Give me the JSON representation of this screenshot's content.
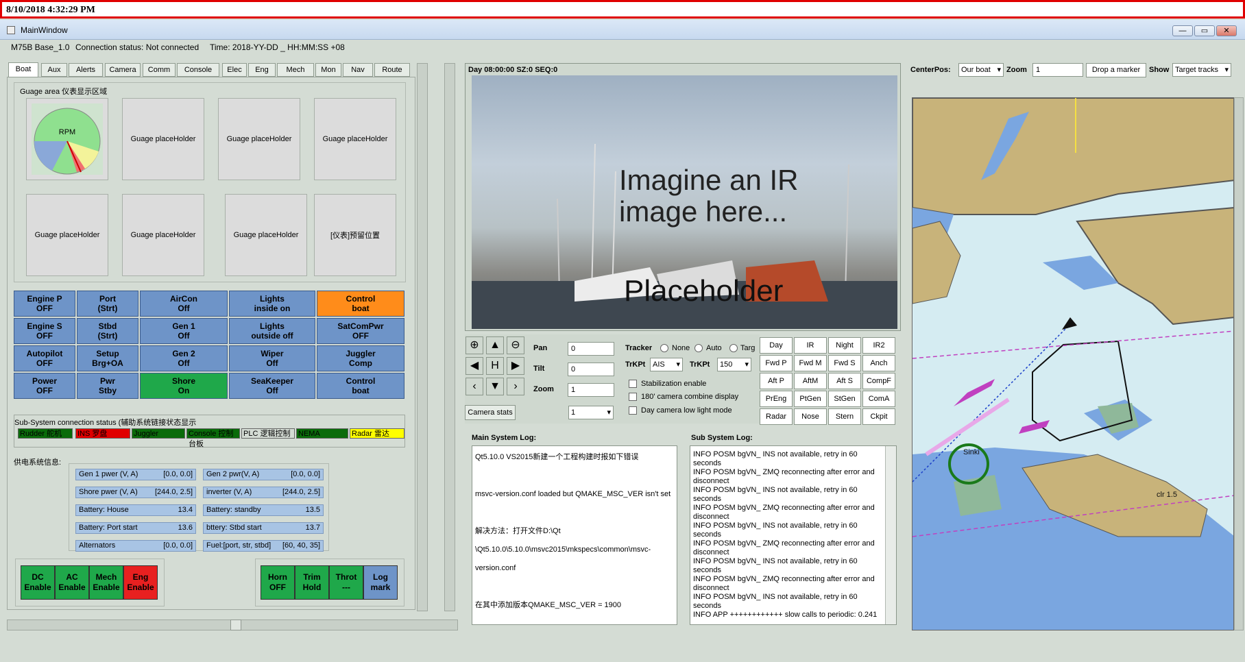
{
  "top_bar": {
    "datetime": "8/10/2018 4:32:29 PM"
  },
  "window": {
    "title": "MainWindow",
    "min": "—",
    "max": "▭",
    "close": "✕"
  },
  "status_bar": {
    "version": "M75B Base_1.0",
    "connection": "Connection status: Not connected",
    "time": "Time: 2018-YY-DD _  HH:MM:SS +08"
  },
  "tabs": [
    "Boat",
    "Aux",
    "Alerts",
    "Camera",
    "Comm",
    "Console",
    "Elec",
    "Eng",
    "Mech",
    "Mon",
    "Nav",
    "Route"
  ],
  "gauge_area": {
    "title": "Guage area 仪表显示区域",
    "rpm_label": "RPM",
    "placeholders": [
      "Guage placeHolder",
      "Guage placeHolder",
      "Guage placeHolder",
      "Guage placeHolder",
      "Guage placeHolder",
      "Guage placeHolder",
      "[仪表]预留位置"
    ]
  },
  "boat_buttons": [
    {
      "label": "Engine P\nOFF"
    },
    {
      "label": "Port\n(Strt)"
    },
    {
      "label": "AirCon\nOff"
    },
    {
      "label": "Lights\ninside on"
    },
    {
      "label": "Control\nboat"
    },
    {
      "label": "Engine S\nOFF"
    },
    {
      "label": "Stbd\n(Strt)"
    },
    {
      "label": "Gen 1\nOff"
    },
    {
      "label": "Lights\noutside off"
    },
    {
      "label": "SatComPwr\nOFF"
    },
    {
      "label": "Autopilot\nOFF"
    },
    {
      "label": "Setup\nBrg+OA"
    },
    {
      "label": "Gen 2\nOff"
    },
    {
      "label": "Wiper\nOff"
    },
    {
      "label": "Juggler\nComp"
    },
    {
      "label": "Power\nOFF"
    },
    {
      "label": "Pwr\nStby"
    },
    {
      "label": "Shore\nOn"
    },
    {
      "label": "SeaKeeper\nOff"
    },
    {
      "label": "Control\nboat"
    }
  ],
  "subsystem": {
    "title": "Sub-System connection status (辅助系统链接状态显示",
    "items": [
      {
        "label": "Rudder 舵机",
        "color": "#0a6b0a"
      },
      {
        "label": "INS 罗盘",
        "color": "#e00000"
      },
      {
        "label": "Juggler",
        "color": "#0a6b0a"
      },
      {
        "label": "Console 控制台板",
        "color": "#0a6b0a"
      },
      {
        "label": "PLC 逻辑控制",
        "color": "#d4dcd4"
      },
      {
        "label": "NEMA",
        "color": "#0a6b0a"
      },
      {
        "label": "Radar 雷达",
        "color": "#ffff00"
      }
    ]
  },
  "power_info": {
    "title": "供电系统信息:",
    "rows": [
      {
        "label": "Gen 1 pwer (V, A)",
        "value": "[0.0, 0.0]"
      },
      {
        "label": "Gen 2 pwr(V, A)",
        "value": "[0.0, 0.0]"
      },
      {
        "label": "Shore pwer (V, A)",
        "value": "[244.0, 2.5]"
      },
      {
        "label": "inverter (V, A)",
        "value": "[244.0, 2.5]"
      },
      {
        "label": "Battery: House",
        "value": "13.4"
      },
      {
        "label": "Battery: standby",
        "value": "13.5"
      },
      {
        "label": "Battery: Port start",
        "value": "13.6"
      },
      {
        "label": "bttery: Stbd start",
        "value": "13.7"
      },
      {
        "label": "Alternators",
        "value": "[0.0, 0.0]"
      },
      {
        "label": "Fuel:[port, str, stbd]",
        "value": "[60, 40, 35]"
      }
    ]
  },
  "bottom_left_buttons": [
    {
      "label": "DC\nEnable",
      "color": "#1fa84a"
    },
    {
      "label": "AC\nEnable",
      "color": "#1fa84a"
    },
    {
      "label": "Mech\nEnable",
      "color": "#1fa84a"
    },
    {
      "label": "Eng\nEnable",
      "color": "#e82020"
    }
  ],
  "bottom_right_buttons": [
    {
      "label": "Horn\nOFF",
      "color": "#1fa84a"
    },
    {
      "label": "Trim\nHold",
      "color": "#1fa84a"
    },
    {
      "label": "Throt\n---",
      "color": "#1fa84a"
    },
    {
      "label": "Log\nmark",
      "color": "#6e94c8"
    }
  ],
  "camera": {
    "header": "Day 08:00:00 SZ:0 SEQ:0",
    "overlay_line1": "Imagine an IR",
    "overlay_line2": "image here...",
    "overlay_placeholder": "Placeholder",
    "pan_label": "Pan",
    "pan_value": "0",
    "tilt_label": "Tilt",
    "tilt_value": "0",
    "zoom_label": "Zoom",
    "zoom_value": "1",
    "stats_button": "Camera stats",
    "select_value": "1",
    "tracker_label": "Tracker",
    "tracker_options": [
      "None",
      "Auto",
      "Targ"
    ],
    "trkpt_label": "TrKPt",
    "trkpt1_value": "AIS",
    "trkpt2_label": "TrKPt",
    "trkpt2_value": "150",
    "checkbox_stab": "Stabilization enable",
    "checkbox_180": "180' camera combine display",
    "checkbox_lowlight": "Day camera low light mode",
    "grid_buttons": [
      "Day",
      "IR",
      "Night",
      "IR2",
      "Fwd P",
      "Fwd M",
      "Fwd S",
      "Anch",
      "Aft P",
      "AftM",
      "Aft S",
      "CompF",
      "PrEng",
      "PtGen",
      "StGen",
      "ComA",
      "Radar",
      "Nose",
      "Stern",
      "Ckpit"
    ]
  },
  "logs": {
    "main_title": "Main System Log:",
    "main_lines": [
      "Qt5.10.0 VS2015新建一个工程构建时报如下错误",
      "",
      "msvc-version.conf loaded but QMAKE_MSC_VER isn't set",
      "",
      "解决方法：打开文件D:\\Qt",
      "\\Qt5.10.0\\5.10.0\\msvc2015\\mkspecs\\common\\msvc-",
      "version.conf",
      "",
      "在其中添加版本QMAKE_MSC_VER = 1900"
    ],
    "sub_title": "Sub System Log:",
    "sub_lines": [
      "INFO    POSM bgVN_ INS not available, retry in 60 seconds",
      "INFO    POSM bgVN_ ZMQ reconnecting after error and disconnect",
      "INFO    POSM bgVN_ INS not available, retry in 60 seconds",
      "INFO    POSM bgVN_ ZMQ reconnecting after error and disconnect",
      "INFO    POSM bgVN_ INS not available, retry in 60 seconds",
      "INFO    POSM bgVN_ ZMQ reconnecting after error and disconnect",
      "INFO    POSM bgVN_ INS not available, retry in 60 seconds",
      "INFO    POSM bgVN_ ZMQ reconnecting after error and disconnect",
      "INFO    POSM bgVN_ INS not available, retry in 60 seconds",
      "INFO    APP   ++++++++++++ slow calls to periodic: 0.241"
    ]
  },
  "map": {
    "centerpos_label": "CenterPos:",
    "centerpos_value": "Our boat",
    "zoom_label": "Zoom",
    "zoom_value": "1",
    "drop_marker": "Drop a marker",
    "show_label": "Show",
    "show_value": "Target tracks",
    "label_sinki": "Sinki",
    "label_depth": "clr 1.5"
  }
}
